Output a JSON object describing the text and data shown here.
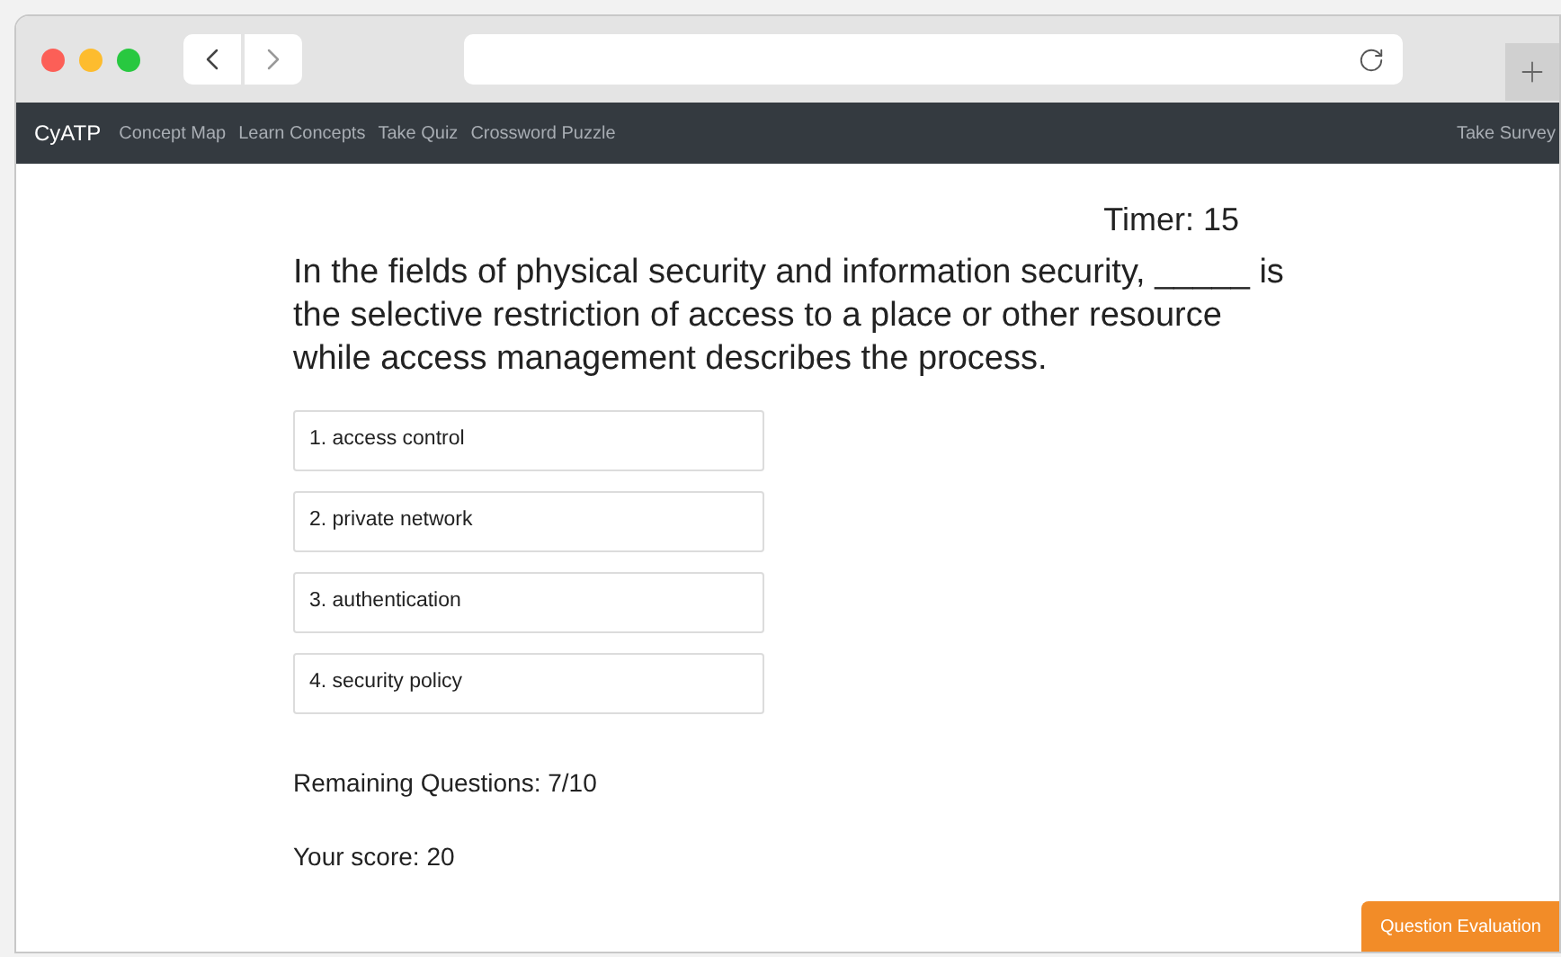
{
  "navbar": {
    "brand": "CyATP",
    "links": [
      "Concept Map",
      "Learn Concepts",
      "Take Quiz",
      "Crossword Puzzle"
    ],
    "right_link": "Take Survey"
  },
  "timer": "Timer: 15",
  "question": "In the fields of physical security and information security, _____ is the selective restriction of access to a place or other resource while access management describes the process.",
  "options": [
    "1. access control",
    "2. private network",
    "3. authentication",
    "4. security policy"
  ],
  "remaining": "Remaining Questions: 7/10",
  "score": "Your score: 20",
  "evaluation_button": "Question Evaluation"
}
